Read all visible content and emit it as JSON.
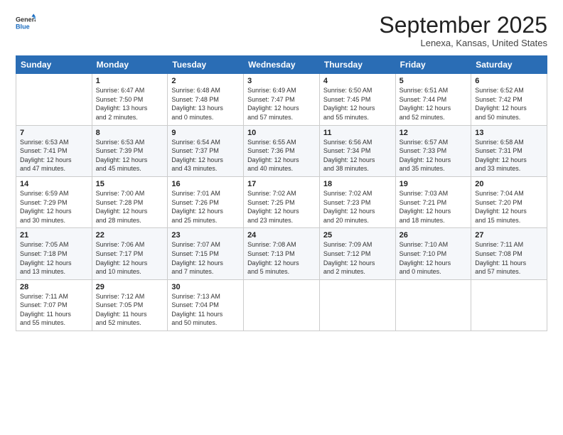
{
  "logo": {
    "general": "General",
    "blue": "Blue"
  },
  "title": "September 2025",
  "subtitle": "Lenexa, Kansas, United States",
  "weekdays": [
    "Sunday",
    "Monday",
    "Tuesday",
    "Wednesday",
    "Thursday",
    "Friday",
    "Saturday"
  ],
  "rows": [
    [
      {
        "num": "",
        "info": ""
      },
      {
        "num": "1",
        "info": "Sunrise: 6:47 AM\nSunset: 7:50 PM\nDaylight: 13 hours\nand 2 minutes."
      },
      {
        "num": "2",
        "info": "Sunrise: 6:48 AM\nSunset: 7:48 PM\nDaylight: 13 hours\nand 0 minutes."
      },
      {
        "num": "3",
        "info": "Sunrise: 6:49 AM\nSunset: 7:47 PM\nDaylight: 12 hours\nand 57 minutes."
      },
      {
        "num": "4",
        "info": "Sunrise: 6:50 AM\nSunset: 7:45 PM\nDaylight: 12 hours\nand 55 minutes."
      },
      {
        "num": "5",
        "info": "Sunrise: 6:51 AM\nSunset: 7:44 PM\nDaylight: 12 hours\nand 52 minutes."
      },
      {
        "num": "6",
        "info": "Sunrise: 6:52 AM\nSunset: 7:42 PM\nDaylight: 12 hours\nand 50 minutes."
      }
    ],
    [
      {
        "num": "7",
        "info": "Sunrise: 6:53 AM\nSunset: 7:41 PM\nDaylight: 12 hours\nand 47 minutes."
      },
      {
        "num": "8",
        "info": "Sunrise: 6:53 AM\nSunset: 7:39 PM\nDaylight: 12 hours\nand 45 minutes."
      },
      {
        "num": "9",
        "info": "Sunrise: 6:54 AM\nSunset: 7:37 PM\nDaylight: 12 hours\nand 43 minutes."
      },
      {
        "num": "10",
        "info": "Sunrise: 6:55 AM\nSunset: 7:36 PM\nDaylight: 12 hours\nand 40 minutes."
      },
      {
        "num": "11",
        "info": "Sunrise: 6:56 AM\nSunset: 7:34 PM\nDaylight: 12 hours\nand 38 minutes."
      },
      {
        "num": "12",
        "info": "Sunrise: 6:57 AM\nSunset: 7:33 PM\nDaylight: 12 hours\nand 35 minutes."
      },
      {
        "num": "13",
        "info": "Sunrise: 6:58 AM\nSunset: 7:31 PM\nDaylight: 12 hours\nand 33 minutes."
      }
    ],
    [
      {
        "num": "14",
        "info": "Sunrise: 6:59 AM\nSunset: 7:29 PM\nDaylight: 12 hours\nand 30 minutes."
      },
      {
        "num": "15",
        "info": "Sunrise: 7:00 AM\nSunset: 7:28 PM\nDaylight: 12 hours\nand 28 minutes."
      },
      {
        "num": "16",
        "info": "Sunrise: 7:01 AM\nSunset: 7:26 PM\nDaylight: 12 hours\nand 25 minutes."
      },
      {
        "num": "17",
        "info": "Sunrise: 7:02 AM\nSunset: 7:25 PM\nDaylight: 12 hours\nand 23 minutes."
      },
      {
        "num": "18",
        "info": "Sunrise: 7:02 AM\nSunset: 7:23 PM\nDaylight: 12 hours\nand 20 minutes."
      },
      {
        "num": "19",
        "info": "Sunrise: 7:03 AM\nSunset: 7:21 PM\nDaylight: 12 hours\nand 18 minutes."
      },
      {
        "num": "20",
        "info": "Sunrise: 7:04 AM\nSunset: 7:20 PM\nDaylight: 12 hours\nand 15 minutes."
      }
    ],
    [
      {
        "num": "21",
        "info": "Sunrise: 7:05 AM\nSunset: 7:18 PM\nDaylight: 12 hours\nand 13 minutes."
      },
      {
        "num": "22",
        "info": "Sunrise: 7:06 AM\nSunset: 7:17 PM\nDaylight: 12 hours\nand 10 minutes."
      },
      {
        "num": "23",
        "info": "Sunrise: 7:07 AM\nSunset: 7:15 PM\nDaylight: 12 hours\nand 7 minutes."
      },
      {
        "num": "24",
        "info": "Sunrise: 7:08 AM\nSunset: 7:13 PM\nDaylight: 12 hours\nand 5 minutes."
      },
      {
        "num": "25",
        "info": "Sunrise: 7:09 AM\nSunset: 7:12 PM\nDaylight: 12 hours\nand 2 minutes."
      },
      {
        "num": "26",
        "info": "Sunrise: 7:10 AM\nSunset: 7:10 PM\nDaylight: 12 hours\nand 0 minutes."
      },
      {
        "num": "27",
        "info": "Sunrise: 7:11 AM\nSunset: 7:08 PM\nDaylight: 11 hours\nand 57 minutes."
      }
    ],
    [
      {
        "num": "28",
        "info": "Sunrise: 7:11 AM\nSunset: 7:07 PM\nDaylight: 11 hours\nand 55 minutes."
      },
      {
        "num": "29",
        "info": "Sunrise: 7:12 AM\nSunset: 7:05 PM\nDaylight: 11 hours\nand 52 minutes."
      },
      {
        "num": "30",
        "info": "Sunrise: 7:13 AM\nSunset: 7:04 PM\nDaylight: 11 hours\nand 50 minutes."
      },
      {
        "num": "",
        "info": ""
      },
      {
        "num": "",
        "info": ""
      },
      {
        "num": "",
        "info": ""
      },
      {
        "num": "",
        "info": ""
      }
    ]
  ]
}
